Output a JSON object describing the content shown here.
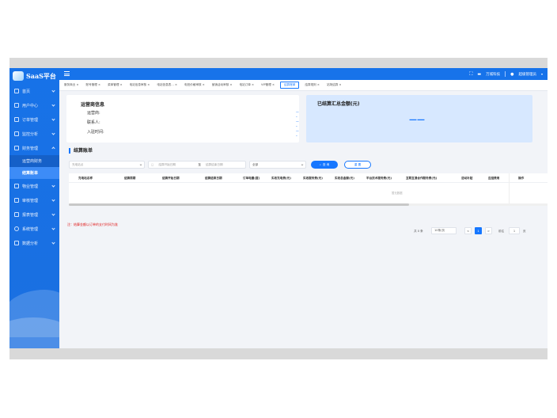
{
  "app": {
    "logo_text": "SaaS平台"
  },
  "header": {
    "company": "万城科技",
    "user": "超级管理员"
  },
  "sidebar": {
    "items": [
      {
        "label": "首页"
      },
      {
        "label": "用户中心"
      },
      {
        "label": "订单管理"
      },
      {
        "label": "监控分析"
      },
      {
        "label": "财务管理"
      }
    ],
    "sub_items": [
      {
        "label": "运营商财务"
      },
      {
        "label": "结算账单"
      }
    ],
    "items2": [
      {
        "label": "物业管理"
      },
      {
        "label": "审核管理"
      },
      {
        "label": "报表管理"
      },
      {
        "label": "系统管理"
      },
      {
        "label": "数据分析"
      }
    ]
  },
  "tabs": [
    {
      "label": "服务商业 ×"
    },
    {
      "label": "账号管理 ×"
    },
    {
      "label": "菜单管理 ×"
    },
    {
      "label": "电站信息审核 ×"
    },
    {
      "label": "电站信息表… ×"
    },
    {
      "label": "电桩价格审核 ×"
    },
    {
      "label": "营销活动审核 ×"
    },
    {
      "label": "电站订单 ×"
    },
    {
      "label": "VIP管理 ×"
    },
    {
      "label": "结算账单"
    },
    {
      "label": "结算规则 ×"
    },
    {
      "label": "站场结算 ×"
    }
  ],
  "operator_card": {
    "title": "运营商信息",
    "rows": [
      {
        "label": "运营商:",
        "value": "---"
      },
      {
        "label": "联系人:",
        "value": "---"
      },
      {
        "label": "入驻时间:",
        "value": "---"
      }
    ]
  },
  "settled_card": {
    "title": "已结算汇总金额(元)",
    "value": "——"
  },
  "section": {
    "title": "结算账单"
  },
  "filters": {
    "station_placeholder": "充电站点",
    "start_placeholder": "结算开始日期",
    "range_sep": "至",
    "end_placeholder": "结算结束日期",
    "status_value": "全部",
    "search_label": "查 询",
    "reset_label": "重 置"
  },
  "table": {
    "headers": [
      "充电站名称",
      "结算周期",
      "结算开始日期",
      "结算结束日期",
      "订单电量(度)",
      "实收充电费(元)",
      "实收服务费(元)",
      "实收总金额(元)",
      "平台技术服务费(元)",
      "互联互通合作服务费(元)",
      "活动补贴",
      "应结费用",
      "操作"
    ],
    "empty_text": "暂无数据"
  },
  "note": "注：结算金额以订单的支付时间为准",
  "pagination": {
    "total": "共 0 条",
    "page_size": "10条/页",
    "prev": "<",
    "current": "1",
    "next": ">",
    "goto_label": "前往",
    "goto_value": "1",
    "page_unit": "页"
  }
}
